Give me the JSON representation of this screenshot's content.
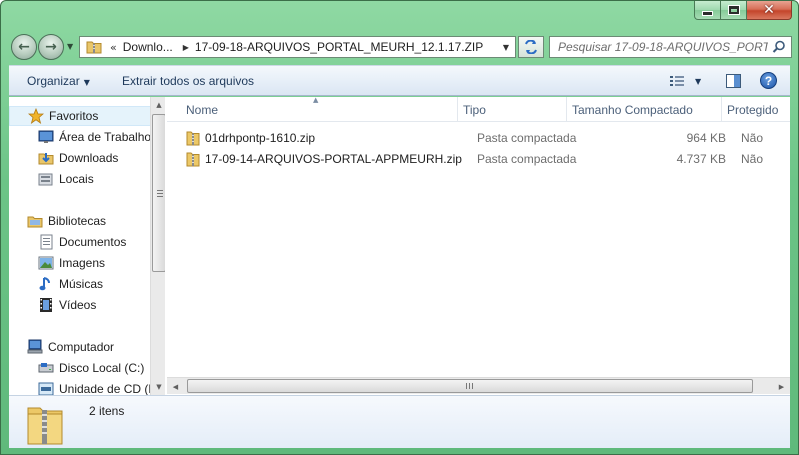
{
  "window": {
    "caption_buttons": {
      "minimize": "minimize-icon",
      "maximize": "maximize-icon",
      "close": "close-icon"
    }
  },
  "address": {
    "overflow": "«",
    "segments": [
      "Downlo...",
      "17-09-18-ARQUIVOS_PORTAL_MEURH_12.1.17.ZIP"
    ]
  },
  "search": {
    "placeholder": "Pesquisar 17-09-18-ARQUIVOS_PORT..."
  },
  "toolbar": {
    "organize_label": "Organizar",
    "extract_label": "Extrair todos os arquivos"
  },
  "navigation": {
    "favorites": {
      "label": "Favoritos",
      "items": [
        {
          "label": "Área de Trabalho",
          "icon": "desktop-icon"
        },
        {
          "label": "Downloads",
          "icon": "downloads-icon"
        },
        {
          "label": "Locais",
          "icon": "recent-places-icon"
        }
      ]
    },
    "libraries": {
      "label": "Bibliotecas",
      "items": [
        {
          "label": "Documentos",
          "icon": "documents-icon"
        },
        {
          "label": "Imagens",
          "icon": "pictures-icon"
        },
        {
          "label": "Músicas",
          "icon": "music-icon"
        },
        {
          "label": "Vídeos",
          "icon": "videos-icon"
        }
      ]
    },
    "computer": {
      "label": "Computador",
      "items": [
        {
          "label": "Disco Local (C:)",
          "icon": "local-disk-icon"
        },
        {
          "label": "Unidade de CD (E",
          "icon": "cd-drive-icon"
        }
      ]
    }
  },
  "file_list": {
    "columns": [
      "Nome",
      "Tipo",
      "Tamanho Compactado",
      "Protegido"
    ],
    "rows": [
      {
        "name": "01drhpontp-1610.zip",
        "type": "Pasta compactada",
        "size": "964 KB",
        "protected": "Não"
      },
      {
        "name": "17-09-14-ARQUIVOS-PORTAL-APPMEURH.zip",
        "type": "Pasta compactada",
        "size": "4.737 KB",
        "protected": "Não"
      }
    ]
  },
  "details": {
    "item_count": "2 itens"
  },
  "colors": {
    "frame": "#6cc487",
    "toolbar_text": "#1e395b",
    "header_text": "#4c607a",
    "secondary_text": "#6d6d6d",
    "selection": "#e5f3fb"
  }
}
